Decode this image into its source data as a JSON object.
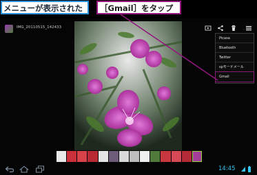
{
  "annotations": {
    "left_callout": "メニューが表示された",
    "right_callout": "［Gmail］をタップ"
  },
  "action_bar": {
    "file_name": "IMG_20110515_142433",
    "icons": [
      "gallery-app-icon",
      "slideshow-icon",
      "share-icon",
      "delete-icon",
      "menu-icon"
    ]
  },
  "share_menu": {
    "items": [
      {
        "label": "Picasa"
      },
      {
        "label": "Bluetooth"
      },
      {
        "label": "Twitter"
      },
      {
        "label": "spモードメール"
      },
      {
        "label": "Gmail",
        "highlighted": true
      }
    ]
  },
  "filmstrip": {
    "thumbnail_count": 14,
    "selected_index": 13
  },
  "nav_bar": {
    "icons": [
      "back-icon",
      "home-icon",
      "recent-apps-icon"
    ],
    "clock": "14:45",
    "status_icons": [
      "wifi-icon",
      "battery-icon"
    ]
  },
  "colors": {
    "left_callout_border": "#2a8fd6",
    "right_callout_border": "#93167e",
    "pointer_line": "#93167e",
    "clock": "#35c7f2"
  }
}
